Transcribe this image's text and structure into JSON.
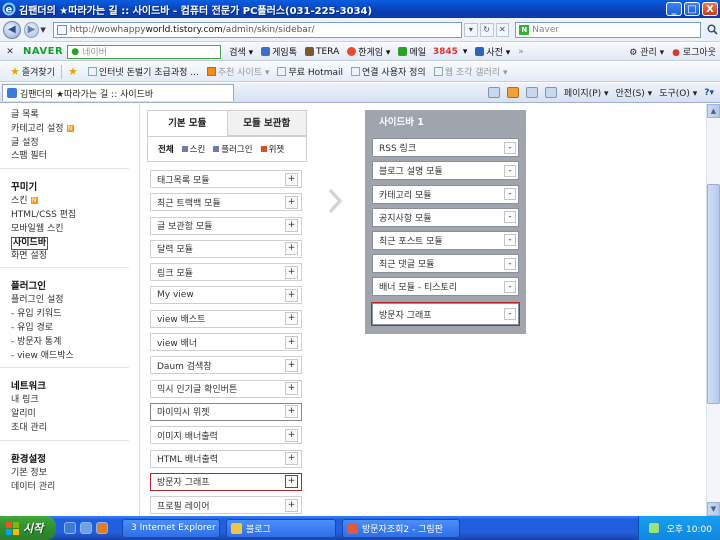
{
  "window": {
    "title": "김팬더의 ★따라가는 길 :: 사이드바 - 컴퓨터 전문가 PC플러스(031-225-3034)",
    "controls": [
      "_",
      "□",
      "X"
    ]
  },
  "address_bar": {
    "url_prefix": "http://wowhappy",
    "url_host": "world.tistory.com",
    "url_path": "/admin/skin/sidebar/",
    "search_placeholder": "Naver"
  },
  "naver_toolbar": {
    "logo": "NAVER",
    "search_placeholder": "네이버",
    "search_label": "검색 ▾",
    "items": [
      {
        "label": "게임톡",
        "color": "#3b6ec8"
      },
      {
        "label": "TERA",
        "color": "#7a5a2b"
      },
      {
        "label": "한게임 ▾",
        "color": "#e84a2f"
      },
      {
        "label": "메일",
        "color": "#2aa02a"
      },
      {
        "label": "사전 ▾",
        "color": "#2a63c4"
      }
    ],
    "mail_count": "3845",
    "right_items": [
      "관리 ▾",
      "로그아웃"
    ]
  },
  "favorites": {
    "label": "즐겨찾기",
    "items": [
      {
        "label": "인터넷 돈벌기 초급과정 ...",
        "grey": false
      },
      {
        "label": "추천 사이트 ▾",
        "grey": true
      },
      {
        "label": "무료 Hotmail",
        "grey": false
      },
      {
        "label": "연결 사용자 정의",
        "grey": false
      },
      {
        "label": "웹 조각 갤러리 ▾",
        "grey": true
      }
    ]
  },
  "tab": {
    "label": "김팬더의 ★따라가는 길 :: 사이드바"
  },
  "commands": [
    "페이지(P) ▾",
    "안전(S) ▾",
    "도구(O) ▾"
  ],
  "left_menu": {
    "top_items": [
      "글 목록",
      "카테고리 설정",
      "글 설정",
      "스팸 필터"
    ],
    "sections": [
      {
        "head": "꾸미기",
        "items": [
          "스킨",
          "HTML/CSS 편집",
          "모바일웹 스킨",
          "사이드바",
          "화면 설정"
        ]
      },
      {
        "head": "플러그인",
        "items": [
          "플러그인 설정",
          "- 유입 키워드",
          "- 유입 경로",
          "- 방문자 통계",
          "- view 애드박스"
        ]
      },
      {
        "head": "네트워크",
        "items": [
          "내 링크",
          "알리미",
          "초대 관리"
        ]
      },
      {
        "head": "환경설정",
        "items": [
          "기본 정보",
          "데이터 관리"
        ]
      }
    ]
  },
  "modules": {
    "tabs": [
      "기본 모듈",
      "모듈 보관함"
    ],
    "filters": [
      "전체",
      "스킨",
      "플러그인",
      "위젯"
    ],
    "filter_colors": [
      "#6a7fae",
      "#6a7fae",
      "#e04b2b"
    ],
    "items": [
      "태그목록 모듈",
      "최근 트랙백 모듈",
      "글 보관함 모듈",
      "달력 모듈",
      "링크 모듈",
      "My view",
      "view 배스트",
      "view 배너",
      "Daum 검색창",
      "믹시 인기글 확인버튼",
      "마이믹시 위젯",
      "이미지 배너출력",
      "HTML 배너출력",
      "방문자 그래프",
      "프로필 레이어"
    ],
    "plus_label": "+"
  },
  "sidebar_panel": {
    "title": "사이드바 1",
    "items": [
      "RSS 링크",
      "블로그 설명 모듈",
      "카테고리 모듈",
      "공지사항 모듈",
      "최근 포스트 모듈",
      "최근 댓글 모듈",
      "배너 모듈 - 티스토리",
      "방문자 그래프"
    ],
    "minus_label": "-"
  },
  "taskbar": {
    "start": "시작",
    "tasks": [
      {
        "label": "3 Internet Explorer ▾",
        "color": "#3a7fe0"
      },
      {
        "label": "블로그",
        "color": "#f0c64a"
      },
      {
        "label": "방문자조회2 - 그림판",
        "color": "#e25a3a"
      }
    ],
    "clock": "오후 10:00"
  }
}
